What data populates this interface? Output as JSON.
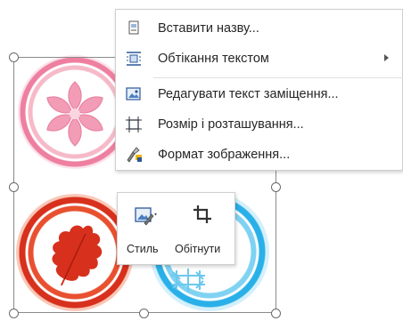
{
  "context_menu": {
    "items": [
      {
        "label": "Вставити назву...",
        "icon": "insert-caption-icon",
        "has_submenu": false
      },
      {
        "label": "Обтікання текстом",
        "icon": "wrap-text-icon",
        "has_submenu": true
      },
      {
        "label": "Редагувати текст заміщення...",
        "icon": "edit-alt-text-icon",
        "has_submenu": false
      },
      {
        "label": "Розмір і розташування...",
        "icon": "size-position-icon",
        "has_submenu": false
      },
      {
        "label": "Формат зображення...",
        "icon": "format-picture-icon",
        "has_submenu": false
      }
    ]
  },
  "mini_toolbar": {
    "style_label": "Стиль",
    "crop_label": "Обітнути"
  },
  "colors": {
    "accent_blue": "#2b579a",
    "pink": "#ee7fa0",
    "red": "#d7301c",
    "yellow": "#f2b600",
    "cyan": "#2ab0e8"
  }
}
